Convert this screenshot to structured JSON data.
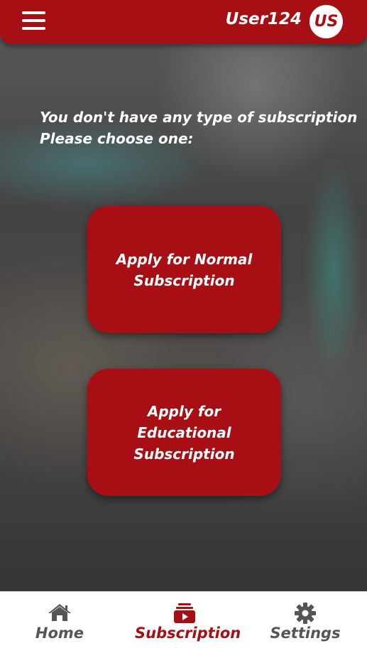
{
  "header": {
    "username": "User124",
    "avatar_initials": "US"
  },
  "main": {
    "message_line1": "You don't have any type of subscription",
    "message_line2": "Please choose one:",
    "normal_button_label": "Apply for Normal Subscription",
    "educational_button_label": "Apply for Educational Subscription"
  },
  "bottom_nav": {
    "items": [
      {
        "label": "Home",
        "icon": "home-icon",
        "active": false
      },
      {
        "label": "Subscription",
        "icon": "subscription-icon",
        "active": true
      },
      {
        "label": "Settings",
        "icon": "gear-icon",
        "active": false
      }
    ]
  },
  "colors": {
    "brand_red": "#a80f15",
    "inactive_gray": "#555555",
    "white": "#ffffff"
  }
}
